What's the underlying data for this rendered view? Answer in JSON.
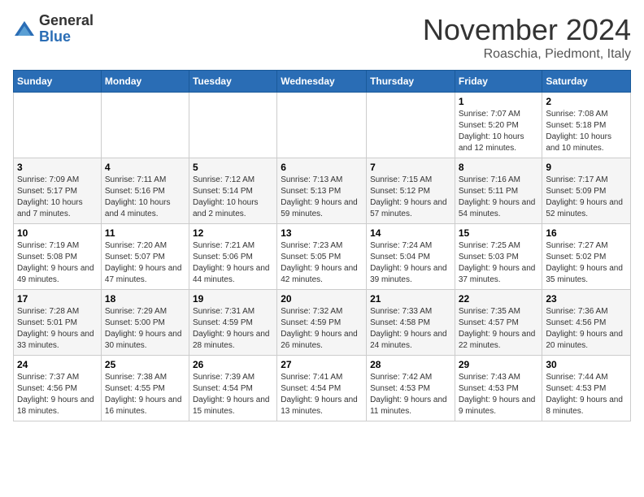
{
  "header": {
    "logo_general": "General",
    "logo_blue": "Blue",
    "month_title": "November 2024",
    "location": "Roaschia, Piedmont, Italy"
  },
  "weekdays": [
    "Sunday",
    "Monday",
    "Tuesday",
    "Wednesday",
    "Thursday",
    "Friday",
    "Saturday"
  ],
  "weeks": [
    [
      {
        "day": "",
        "info": ""
      },
      {
        "day": "",
        "info": ""
      },
      {
        "day": "",
        "info": ""
      },
      {
        "day": "",
        "info": ""
      },
      {
        "day": "",
        "info": ""
      },
      {
        "day": "1",
        "info": "Sunrise: 7:07 AM\nSunset: 5:20 PM\nDaylight: 10 hours and 12 minutes."
      },
      {
        "day": "2",
        "info": "Sunrise: 7:08 AM\nSunset: 5:18 PM\nDaylight: 10 hours and 10 minutes."
      }
    ],
    [
      {
        "day": "3",
        "info": "Sunrise: 7:09 AM\nSunset: 5:17 PM\nDaylight: 10 hours and 7 minutes."
      },
      {
        "day": "4",
        "info": "Sunrise: 7:11 AM\nSunset: 5:16 PM\nDaylight: 10 hours and 4 minutes."
      },
      {
        "day": "5",
        "info": "Sunrise: 7:12 AM\nSunset: 5:14 PM\nDaylight: 10 hours and 2 minutes."
      },
      {
        "day": "6",
        "info": "Sunrise: 7:13 AM\nSunset: 5:13 PM\nDaylight: 9 hours and 59 minutes."
      },
      {
        "day": "7",
        "info": "Sunrise: 7:15 AM\nSunset: 5:12 PM\nDaylight: 9 hours and 57 minutes."
      },
      {
        "day": "8",
        "info": "Sunrise: 7:16 AM\nSunset: 5:11 PM\nDaylight: 9 hours and 54 minutes."
      },
      {
        "day": "9",
        "info": "Sunrise: 7:17 AM\nSunset: 5:09 PM\nDaylight: 9 hours and 52 minutes."
      }
    ],
    [
      {
        "day": "10",
        "info": "Sunrise: 7:19 AM\nSunset: 5:08 PM\nDaylight: 9 hours and 49 minutes."
      },
      {
        "day": "11",
        "info": "Sunrise: 7:20 AM\nSunset: 5:07 PM\nDaylight: 9 hours and 47 minutes."
      },
      {
        "day": "12",
        "info": "Sunrise: 7:21 AM\nSunset: 5:06 PM\nDaylight: 9 hours and 44 minutes."
      },
      {
        "day": "13",
        "info": "Sunrise: 7:23 AM\nSunset: 5:05 PM\nDaylight: 9 hours and 42 minutes."
      },
      {
        "day": "14",
        "info": "Sunrise: 7:24 AM\nSunset: 5:04 PM\nDaylight: 9 hours and 39 minutes."
      },
      {
        "day": "15",
        "info": "Sunrise: 7:25 AM\nSunset: 5:03 PM\nDaylight: 9 hours and 37 minutes."
      },
      {
        "day": "16",
        "info": "Sunrise: 7:27 AM\nSunset: 5:02 PM\nDaylight: 9 hours and 35 minutes."
      }
    ],
    [
      {
        "day": "17",
        "info": "Sunrise: 7:28 AM\nSunset: 5:01 PM\nDaylight: 9 hours and 33 minutes."
      },
      {
        "day": "18",
        "info": "Sunrise: 7:29 AM\nSunset: 5:00 PM\nDaylight: 9 hours and 30 minutes."
      },
      {
        "day": "19",
        "info": "Sunrise: 7:31 AM\nSunset: 4:59 PM\nDaylight: 9 hours and 28 minutes."
      },
      {
        "day": "20",
        "info": "Sunrise: 7:32 AM\nSunset: 4:59 PM\nDaylight: 9 hours and 26 minutes."
      },
      {
        "day": "21",
        "info": "Sunrise: 7:33 AM\nSunset: 4:58 PM\nDaylight: 9 hours and 24 minutes."
      },
      {
        "day": "22",
        "info": "Sunrise: 7:35 AM\nSunset: 4:57 PM\nDaylight: 9 hours and 22 minutes."
      },
      {
        "day": "23",
        "info": "Sunrise: 7:36 AM\nSunset: 4:56 PM\nDaylight: 9 hours and 20 minutes."
      }
    ],
    [
      {
        "day": "24",
        "info": "Sunrise: 7:37 AM\nSunset: 4:56 PM\nDaylight: 9 hours and 18 minutes."
      },
      {
        "day": "25",
        "info": "Sunrise: 7:38 AM\nSunset: 4:55 PM\nDaylight: 9 hours and 16 minutes."
      },
      {
        "day": "26",
        "info": "Sunrise: 7:39 AM\nSunset: 4:54 PM\nDaylight: 9 hours and 15 minutes."
      },
      {
        "day": "27",
        "info": "Sunrise: 7:41 AM\nSunset: 4:54 PM\nDaylight: 9 hours and 13 minutes."
      },
      {
        "day": "28",
        "info": "Sunrise: 7:42 AM\nSunset: 4:53 PM\nDaylight: 9 hours and 11 minutes."
      },
      {
        "day": "29",
        "info": "Sunrise: 7:43 AM\nSunset: 4:53 PM\nDaylight: 9 hours and 9 minutes."
      },
      {
        "day": "30",
        "info": "Sunrise: 7:44 AM\nSunset: 4:53 PM\nDaylight: 9 hours and 8 minutes."
      }
    ]
  ]
}
